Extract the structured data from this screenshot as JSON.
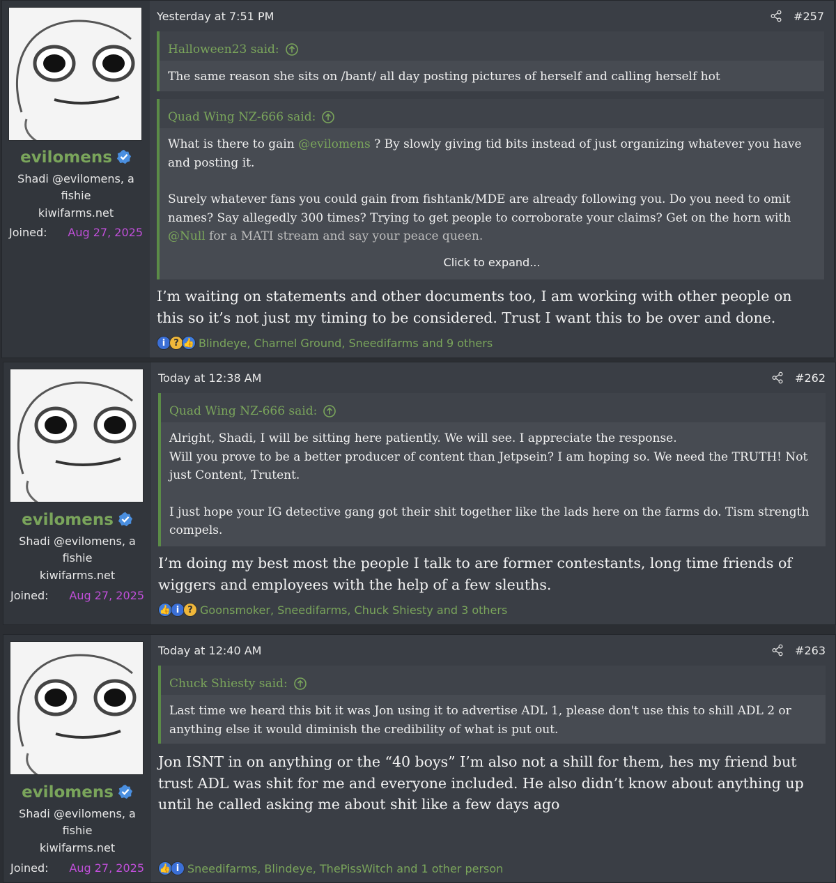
{
  "posts": [
    {
      "user": {
        "name": "evilomens",
        "title": "Shadi @evilomens, a fishie",
        "site": "kiwifarms.net",
        "joined_label": "Joined:",
        "joined": "Aug 27, 2025"
      },
      "date": "Yesterday at 7:51 PM",
      "number": "#257",
      "quotes": [
        {
          "author": "Halloween23 said:",
          "paragraphs": [
            "The same reason she sits on /bant/ all day posting pictures of herself and calling herself hot"
          ]
        },
        {
          "author": "Quad Wing NZ-666 said:",
          "p1_a": "What is there to gain ",
          "p1_mention": "@evilomens",
          "p1_b": " ? By slowly giving tid bits instead of just organizing whatever you have and posting it.",
          "p2_a": "Surely whatever fans you could gain from fishtank/MDE are already following you. Do you need to omit names? Say allegedly 300 times? Trying to get people to corroborate your claims? Get on the horn with ",
          "p2_mention": "@Null",
          "p2_b": " for a MATI stream and say your peace queen.",
          "expand": "Click to expand..."
        }
      ],
      "message": "I’m waiting on statements and other documents too, I am working with other people on this so it’s not just my timing to be considered. Trust I want this to be over and done.",
      "reactions": "Blindeye, Charnel Ground, Sneedifarms and 9 others"
    },
    {
      "user": {
        "name": "evilomens",
        "title": "Shadi @evilomens, a fishie",
        "site": "kiwifarms.net",
        "joined_label": "Joined:",
        "joined": "Aug 27, 2025"
      },
      "date": "Today at 12:38 AM",
      "number": "#262",
      "quotes": [
        {
          "author": "Quad Wing NZ-666 said:",
          "line1": "Alright, Shadi, I will be sitting here patiently. We will see. I appreciate the response.",
          "line2": "Will you prove to be a better producer of content than Jetpsein? I am hoping so. We need the TRUTH! Not just Content, Trutent.",
          "line3": "I just hope your IG detective gang got their shit together like the lads here on the farms do. Tism strength compels."
        }
      ],
      "message": "I’m doing my best most the people I talk to are former contestants, long time friends of wiggers and employees with the help of a few sleuths.",
      "reactions": "Goonsmoker, Sneedifarms, Chuck Shiesty and 3 others"
    },
    {
      "user": {
        "name": "evilomens",
        "title": "Shadi @evilomens, a fishie",
        "site": "kiwifarms.net",
        "joined_label": "Joined:",
        "joined": "Aug 27, 2025"
      },
      "date": "Today at 12:40 AM",
      "number": "#263",
      "quotes": [
        {
          "author": "Chuck Shiesty said:",
          "text": "Last time we heard this bit it was Jon using it to advertise ADL 1, please don't use this to shill ADL 2 or anything else it would diminish the credibility of what is put out."
        }
      ],
      "message": "Jon ISNT in on anything or the “40 boys” I’m also not a shill for them, hes my friend but trust ADL was shit for me and everyone included. He also didn’t know about anything up until he called asking me about shit like a few days ago",
      "reactions": "Sneedifarms, Blindeye, ThePissWitch and 1 other person"
    }
  ],
  "colors": {
    "accent_green": "#7aa55b",
    "joined_purple": "#c04fd9",
    "quote_bar": "#5b8c47"
  },
  "icons": [
    "share-icon",
    "up-arrow-icon",
    "verified-icon",
    "info-react-icon",
    "thinking-react-icon",
    "like-react-icon"
  ]
}
